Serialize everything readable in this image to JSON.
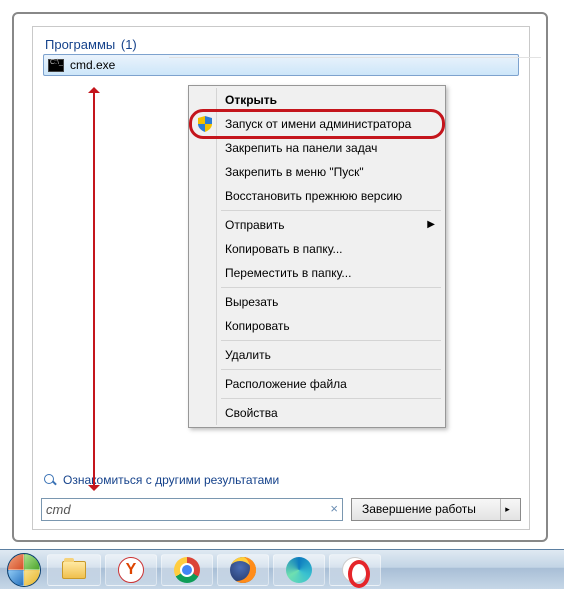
{
  "group": {
    "title": "Программы",
    "count": "(1)"
  },
  "result": {
    "name": "cmd.exe"
  },
  "context_menu": {
    "open": "Открыть",
    "run_as_admin": "Запуск от имени администратора",
    "pin_taskbar": "Закрепить на панели задач",
    "pin_start": "Закрепить в меню \"Пуск\"",
    "restore": "Восстановить прежнюю версию",
    "send_to": "Отправить",
    "copy_to": "Копировать в папку...",
    "move_to": "Переместить в папку...",
    "cut": "Вырезать",
    "copy": "Копировать",
    "delete": "Удалить",
    "location": "Расположение файла",
    "properties": "Свойства"
  },
  "see_more": "Ознакомиться с другими результатами",
  "search": {
    "value": "cmd"
  },
  "shutdown": {
    "label": "Завершение работы"
  }
}
